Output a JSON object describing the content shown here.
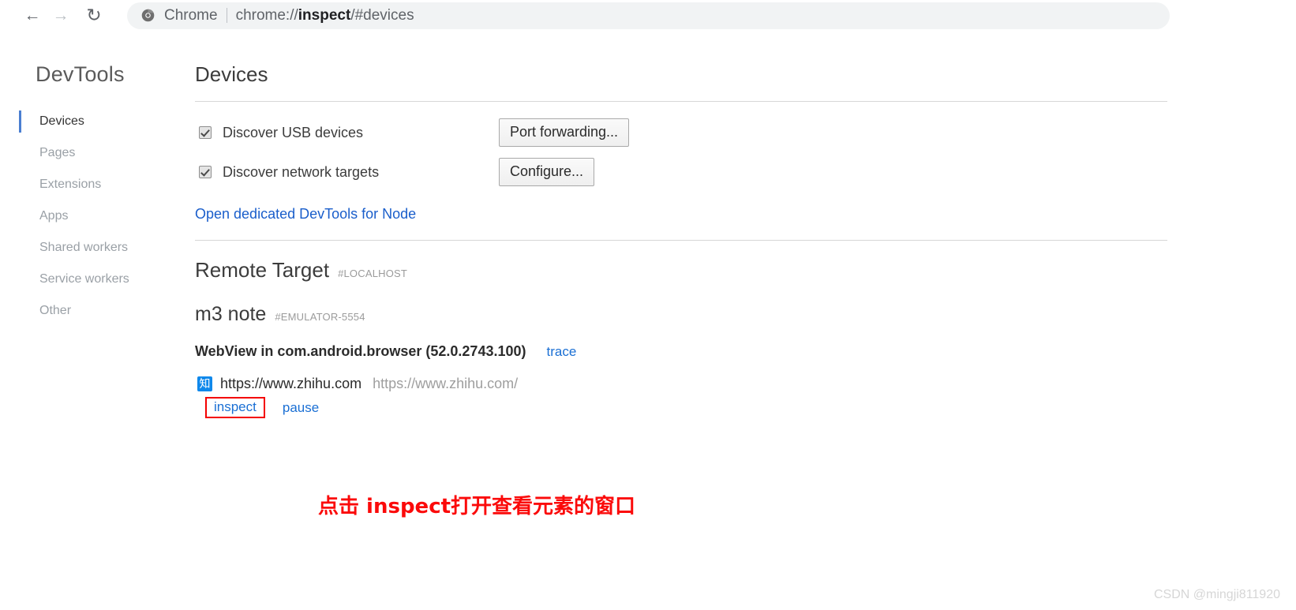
{
  "browser": {
    "back_icon": "arrow-left-icon",
    "forward_icon": "arrow-right-icon",
    "reload_icon": "reload-icon",
    "chrome_logo": "chrome-logo-icon",
    "brand_label": "Chrome",
    "url_prefix": "chrome://",
    "url_bold": "inspect",
    "url_suffix": "/#devices",
    "url_full": "chrome://inspect/#devices"
  },
  "sidebar": {
    "title": "DevTools",
    "items": [
      {
        "label": "Devices",
        "selected": true
      },
      {
        "label": "Pages",
        "selected": false
      },
      {
        "label": "Extensions",
        "selected": false
      },
      {
        "label": "Apps",
        "selected": false
      },
      {
        "label": "Shared workers",
        "selected": false
      },
      {
        "label": "Service workers",
        "selected": false
      },
      {
        "label": "Other",
        "selected": false
      }
    ]
  },
  "main": {
    "section_title": "Devices",
    "options": [
      {
        "label": "Discover USB devices",
        "checked": true,
        "button": "Port forwarding..."
      },
      {
        "label": "Discover network targets",
        "checked": true,
        "button": "Configure..."
      }
    ],
    "node_link": "Open dedicated DevTools for Node",
    "remote_target": {
      "heading": "Remote Target",
      "tag": "#LOCALHOST"
    },
    "device": {
      "name": "m3 note",
      "tag": "#EMULATOR-5554"
    },
    "target": {
      "title": "WebView in com.android.browser (52.0.2743.100)",
      "trace_label": "trace",
      "favicon_glyph": "知",
      "favicon_color": "#0f88eb",
      "page_name": "https://www.zhihu.com",
      "page_url": "https://www.zhihu.com/",
      "inspect_label": "inspect",
      "pause_label": "pause",
      "highlight_color": "#f40000"
    }
  },
  "annotation": {
    "text": "点击 inspect打开查看元素的窗口",
    "color": "#fb0a0a"
  },
  "watermark": {
    "text": "CSDN @mingji811920"
  }
}
